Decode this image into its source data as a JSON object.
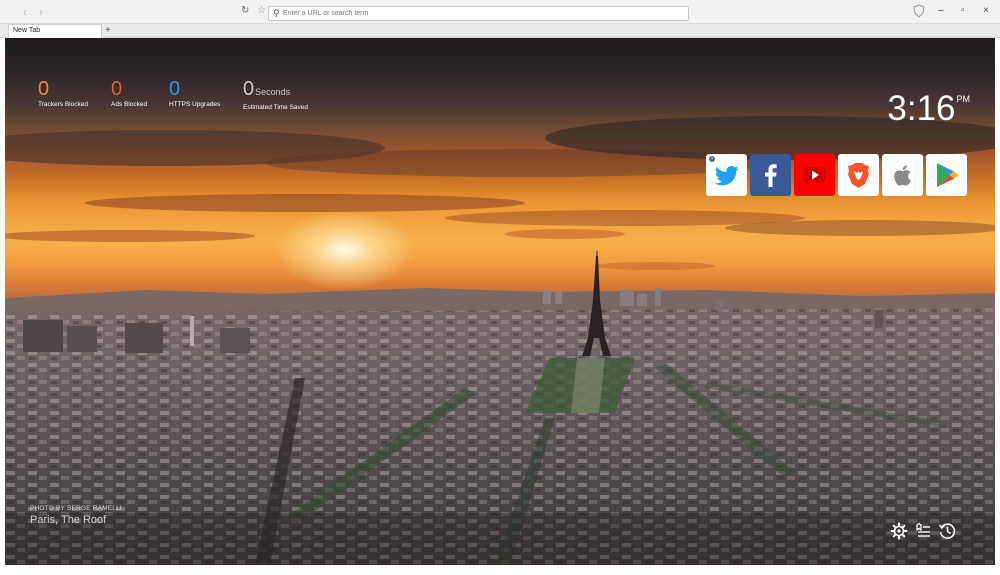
{
  "browser": {
    "url_placeholder": "Enter a URL or search term",
    "tab_title": "New Tab",
    "new_tab_symbol": "+",
    "window_controls": [
      "–",
      "▫",
      "×"
    ],
    "menu_symbol": "⋮"
  },
  "stats": [
    {
      "value": "0",
      "label": "Trackers Blocked",
      "unit": "",
      "color": "#f28a2e"
    },
    {
      "value": "0",
      "label": "Ads Blocked",
      "unit": "",
      "color": "#ef5a2a"
    },
    {
      "value": "0",
      "label": "HTTPS Upgrades",
      "unit": "",
      "color": "#2c97e8"
    },
    {
      "value": "0",
      "label": "Estimated Time Saved",
      "unit": "Seconds",
      "color": "#c9c9c9"
    }
  ],
  "clock": {
    "time": "3:16",
    "ampm": "PM"
  },
  "top_sites": [
    {
      "name": "twitter",
      "icon": "twitter-bird-icon",
      "bg": "#ffffff",
      "fg": "#1da1f2",
      "pinned": true
    },
    {
      "name": "facebook",
      "icon": "facebook-f-icon",
      "bg": "#3b5998",
      "fg": "#ffffff",
      "pinned": false
    },
    {
      "name": "youtube",
      "icon": "youtube-play-icon",
      "bg": "#ff0000",
      "fg": "#ffffff",
      "pinned": false
    },
    {
      "name": "brave",
      "icon": "brave-lion-icon",
      "bg": "#ffffff",
      "fg": "#fb542b",
      "pinned": false
    },
    {
      "name": "apple",
      "icon": "apple-logo-icon",
      "bg": "#ffffff",
      "fg": "#888888",
      "pinned": false
    },
    {
      "name": "google-play",
      "icon": "google-play-icon",
      "bg": "#ffffff",
      "fg": "#34a853",
      "pinned": false
    }
  ],
  "photo_credit": {
    "by": "PHOTO BY SERGE RAMELLI",
    "place": "Paris, The Roof"
  },
  "bottom_icons": [
    "settings-gear-icon",
    "bookmarks-list-icon",
    "history-clock-icon"
  ]
}
